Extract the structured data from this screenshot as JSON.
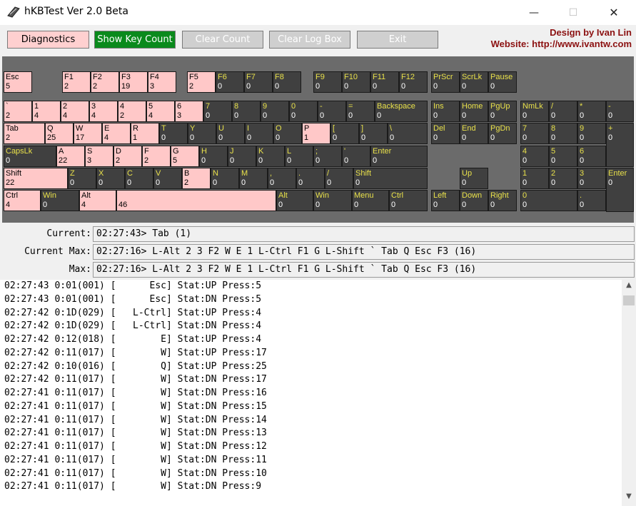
{
  "window": {
    "title": "hKBTest Ver 2.0 Beta",
    "min": "—",
    "max": "☐",
    "close": "✕"
  },
  "toolbar": {
    "diagnostics": "Diagnostics",
    "show_key_count": "Show Key Count",
    "clear_count": "Clear Count",
    "clear_log_box": "Clear Log Box",
    "exit": "Exit"
  },
  "credits": {
    "line1": "Design by Ivan Lin",
    "line2": "Website: http://www.ivantw.com"
  },
  "keyboard": [
    {
      "id": "esc",
      "label": "Esc",
      "count": "5",
      "on": true
    },
    {
      "id": "f1",
      "label": "F1",
      "count": "2",
      "on": true
    },
    {
      "id": "f2",
      "label": "F2",
      "count": "2",
      "on": true
    },
    {
      "id": "f3",
      "label": "F3",
      "count": "19",
      "on": true
    },
    {
      "id": "f4",
      "label": "F4",
      "count": "3",
      "on": true
    },
    {
      "id": "f5",
      "label": "F5",
      "count": "2",
      "on": true
    },
    {
      "id": "f6",
      "label": "F6",
      "count": "0",
      "on": false
    },
    {
      "id": "f7",
      "label": "F7",
      "count": "0",
      "on": false
    },
    {
      "id": "f8",
      "label": "F8",
      "count": "0",
      "on": false
    },
    {
      "id": "f9",
      "label": "F9",
      "count": "0",
      "on": false
    },
    {
      "id": "f10",
      "label": "F10",
      "count": "0",
      "on": false
    },
    {
      "id": "f11",
      "label": "F11",
      "count": "0",
      "on": false
    },
    {
      "id": "f12",
      "label": "F12",
      "count": "0",
      "on": false
    },
    {
      "id": "prscr",
      "label": "PrScr",
      "count": "0",
      "on": false
    },
    {
      "id": "scrlk",
      "label": "ScrLk",
      "count": "0",
      "on": false
    },
    {
      "id": "pause",
      "label": "Pause",
      "count": "0",
      "on": false
    },
    {
      "id": "backtick",
      "label": "`",
      "count": "2",
      "on": true
    },
    {
      "id": "d1",
      "label": "1",
      "count": "4",
      "on": true
    },
    {
      "id": "d2",
      "label": "2",
      "count": "4",
      "on": true
    },
    {
      "id": "d3",
      "label": "3",
      "count": "4",
      "on": true
    },
    {
      "id": "d4",
      "label": "4",
      "count": "2",
      "on": true
    },
    {
      "id": "d5",
      "label": "5",
      "count": "4",
      "on": true
    },
    {
      "id": "d6",
      "label": "6",
      "count": "3",
      "on": true
    },
    {
      "id": "d7",
      "label": "7",
      "count": "0",
      "on": false
    },
    {
      "id": "d8",
      "label": "8",
      "count": "0",
      "on": false
    },
    {
      "id": "d9",
      "label": "9",
      "count": "0",
      "on": false
    },
    {
      "id": "d0",
      "label": "0",
      "count": "0",
      "on": false
    },
    {
      "id": "minus",
      "label": "-",
      "count": "0",
      "on": false
    },
    {
      "id": "equals",
      "label": "=",
      "count": "0",
      "on": false
    },
    {
      "id": "backspace",
      "label": "Backspace",
      "count": "0",
      "on": false
    },
    {
      "id": "ins",
      "label": "Ins",
      "count": "0",
      "on": false
    },
    {
      "id": "home",
      "label": "Home",
      "count": "0",
      "on": false
    },
    {
      "id": "pgup",
      "label": "PgUp",
      "count": "0",
      "on": false
    },
    {
      "id": "nmlk",
      "label": "NmLk",
      "count": "0",
      "on": false
    },
    {
      "id": "np-div",
      "label": "/",
      "count": "0",
      "on": false
    },
    {
      "id": "np-mul",
      "label": "*",
      "count": "0",
      "on": false
    },
    {
      "id": "np-sub",
      "label": "-",
      "count": "0",
      "on": false
    },
    {
      "id": "tab",
      "label": "Tab",
      "count": "2",
      "on": true
    },
    {
      "id": "q",
      "label": "Q",
      "count": "25",
      "on": true
    },
    {
      "id": "w",
      "label": "W",
      "count": "17",
      "on": true
    },
    {
      "id": "e",
      "label": "E",
      "count": "4",
      "on": true
    },
    {
      "id": "r",
      "label": "R",
      "count": "1",
      "on": true
    },
    {
      "id": "t",
      "label": "T",
      "count": "0",
      "on": false
    },
    {
      "id": "y",
      "label": "Y",
      "count": "0",
      "on": false
    },
    {
      "id": "u",
      "label": "U",
      "count": "0",
      "on": false
    },
    {
      "id": "i",
      "label": "I",
      "count": "0",
      "on": false
    },
    {
      "id": "o",
      "label": "O",
      "count": "0",
      "on": false
    },
    {
      "id": "p",
      "label": "P",
      "count": "1",
      "on": true
    },
    {
      "id": "lbracket",
      "label": "[",
      "count": "0",
      "on": false
    },
    {
      "id": "rbracket",
      "label": "]",
      "count": "0",
      "on": false
    },
    {
      "id": "backslash",
      "label": "\\",
      "count": "0",
      "on": false
    },
    {
      "id": "del",
      "label": "Del",
      "count": "0",
      "on": false
    },
    {
      "id": "end",
      "label": "End",
      "count": "0",
      "on": false
    },
    {
      "id": "pgdn",
      "label": "PgDn",
      "count": "0",
      "on": false
    },
    {
      "id": "np7",
      "label": "7",
      "count": "0",
      "on": false
    },
    {
      "id": "np8",
      "label": "8",
      "count": "0",
      "on": false
    },
    {
      "id": "np9",
      "label": "9",
      "count": "0",
      "on": false
    },
    {
      "id": "np-add",
      "label": "+",
      "count": "0",
      "on": false
    },
    {
      "id": "capslk",
      "label": "CapsLk",
      "count": "0",
      "on": false
    },
    {
      "id": "a",
      "label": "A",
      "count": "22",
      "on": true
    },
    {
      "id": "s",
      "label": "S",
      "count": "3",
      "on": true
    },
    {
      "id": "d",
      "label": "D",
      "count": "2",
      "on": true
    },
    {
      "id": "f",
      "label": "F",
      "count": "2",
      "on": true
    },
    {
      "id": "g",
      "label": "G",
      "count": "5",
      "on": true
    },
    {
      "id": "h",
      "label": "H",
      "count": "0",
      "on": false
    },
    {
      "id": "j",
      "label": "J",
      "count": "0",
      "on": false
    },
    {
      "id": "k",
      "label": "K",
      "count": "0",
      "on": false
    },
    {
      "id": "l",
      "label": "L",
      "count": "0",
      "on": false
    },
    {
      "id": "semicolon",
      "label": ";",
      "count": "0",
      "on": false
    },
    {
      "id": "quote",
      "label": "'",
      "count": "0",
      "on": false
    },
    {
      "id": "enter",
      "label": "Enter",
      "count": "0",
      "on": false
    },
    {
      "id": "np4",
      "label": "4",
      "count": "0",
      "on": false
    },
    {
      "id": "np5",
      "label": "5",
      "count": "0",
      "on": false
    },
    {
      "id": "np6",
      "label": "6",
      "count": "0",
      "on": false
    },
    {
      "id": "lshift",
      "label": "Shift",
      "count": "22",
      "on": true
    },
    {
      "id": "z",
      "label": "Z",
      "count": "0",
      "on": false
    },
    {
      "id": "x",
      "label": "X",
      "count": "0",
      "on": false
    },
    {
      "id": "c",
      "label": "C",
      "count": "0",
      "on": false
    },
    {
      "id": "v",
      "label": "V",
      "count": "0",
      "on": false
    },
    {
      "id": "b",
      "label": "B",
      "count": "2",
      "on": true
    },
    {
      "id": "n",
      "label": "N",
      "count": "0",
      "on": false
    },
    {
      "id": "m",
      "label": "M",
      "count": "0",
      "on": false
    },
    {
      "id": "comma",
      "label": ",",
      "count": "0",
      "on": false
    },
    {
      "id": "period",
      "label": ".",
      "count": "0",
      "on": false
    },
    {
      "id": "slash",
      "label": "/",
      "count": "0",
      "on": false
    },
    {
      "id": "rshift",
      "label": "Shift",
      "count": "0",
      "on": false
    },
    {
      "id": "up",
      "label": "Up",
      "count": "0",
      "on": false
    },
    {
      "id": "np1",
      "label": "1",
      "count": "0",
      "on": false
    },
    {
      "id": "np2",
      "label": "2",
      "count": "0",
      "on": false
    },
    {
      "id": "np3",
      "label": "3",
      "count": "0",
      "on": false
    },
    {
      "id": "np-enter",
      "label": "Enter",
      "count": "0",
      "on": false
    },
    {
      "id": "lctrl",
      "label": "Ctrl",
      "count": "4",
      "on": true
    },
    {
      "id": "lwin",
      "label": "Win",
      "count": "0",
      "on": false
    },
    {
      "id": "lalt",
      "label": "Alt",
      "count": "4",
      "on": true
    },
    {
      "id": "space",
      "label": "",
      "count": "46",
      "on": true
    },
    {
      "id": "ralt",
      "label": "Alt",
      "count": "0",
      "on": false
    },
    {
      "id": "rwin",
      "label": "Win",
      "count": "0",
      "on": false
    },
    {
      "id": "menu",
      "label": "Menu",
      "count": "0",
      "on": false
    },
    {
      "id": "rctrl",
      "label": "Ctrl",
      "count": "0",
      "on": false
    },
    {
      "id": "left",
      "label": "Left",
      "count": "0",
      "on": false
    },
    {
      "id": "down",
      "label": "Down",
      "count": "0",
      "on": false
    },
    {
      "id": "right",
      "label": "Right",
      "count": "0",
      "on": false
    },
    {
      "id": "np0",
      "label": "0",
      "count": "0",
      "on": false
    },
    {
      "id": "np-dot",
      "label": ".",
      "count": "0",
      "on": false
    }
  ],
  "status": {
    "current_label": "Current:",
    "current_value": "02:27:43> Tab (1)",
    "current_max_label": "Current Max:",
    "current_max_value": "02:27:16> L-Alt 2 3 F2 W E 1 L-Ctrl F1 G L-Shift ` Tab Q Esc F3 (16)",
    "max_label": "Max:",
    "max_value": "02:27:16> L-Alt 2 3 F2 W E 1 L-Ctrl F1 G L-Shift ` Tab Q Esc F3 (16)"
  },
  "log": [
    "02:27:43 0:01(001) [      Esc] Stat:UP Press:5",
    "02:27:43 0:01(001) [      Esc] Stat:DN Press:5",
    "02:27:42 0:1D(029) [   L-Ctrl] Stat:UP Press:4",
    "02:27:42 0:1D(029) [   L-Ctrl] Stat:DN Press:4",
    "02:27:42 0:12(018) [        E] Stat:UP Press:4",
    "02:27:42 0:11(017) [        W] Stat:UP Press:17",
    "02:27:42 0:10(016) [        Q] Stat:UP Press:25",
    "02:27:42 0:11(017) [        W] Stat:DN Press:17",
    "02:27:41 0:11(017) [        W] Stat:DN Press:16",
    "02:27:41 0:11(017) [        W] Stat:DN Press:15",
    "02:27:41 0:11(017) [        W] Stat:DN Press:14",
    "02:27:41 0:11(017) [        W] Stat:DN Press:13",
    "02:27:41 0:11(017) [        W] Stat:DN Press:12",
    "02:27:41 0:11(017) [        W] Stat:DN Press:11",
    "02:27:41 0:11(017) [        W] Stat:DN Press:10",
    "02:27:41 0:11(017) [        W] Stat:DN Press:9"
  ],
  "scrollbar": {
    "up": "▲",
    "down": "▼"
  }
}
